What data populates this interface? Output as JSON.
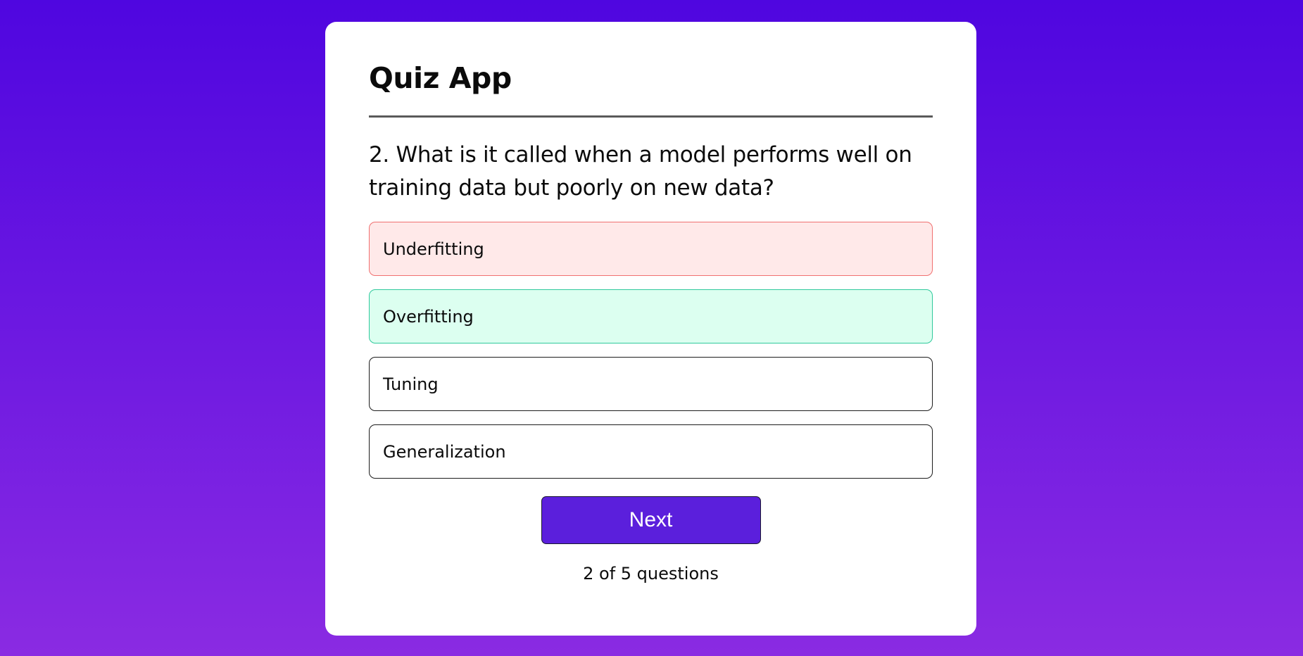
{
  "app": {
    "title": "Quiz App"
  },
  "question": {
    "text": "2. What is it called when a model performs well on training data but poorly on new data?"
  },
  "answers": [
    {
      "label": "Underfitting",
      "state": "wrong"
    },
    {
      "label": "Overfitting",
      "state": "correct"
    },
    {
      "label": "Tuning",
      "state": "neutral"
    },
    {
      "label": "Generalization",
      "state": "neutral"
    }
  ],
  "next_button": {
    "label": "Next"
  },
  "progress": {
    "text": "2 of 5 questions",
    "current": 2,
    "total": 5
  },
  "colors": {
    "background_top": "#4f06e0",
    "background_bottom": "#8a2be2",
    "wrong_bg": "#ffe9e9",
    "wrong_border": "#f07070",
    "correct_bg": "#dcfff0",
    "correct_border": "#2fc99c",
    "button_bg": "#5b1fdc"
  }
}
